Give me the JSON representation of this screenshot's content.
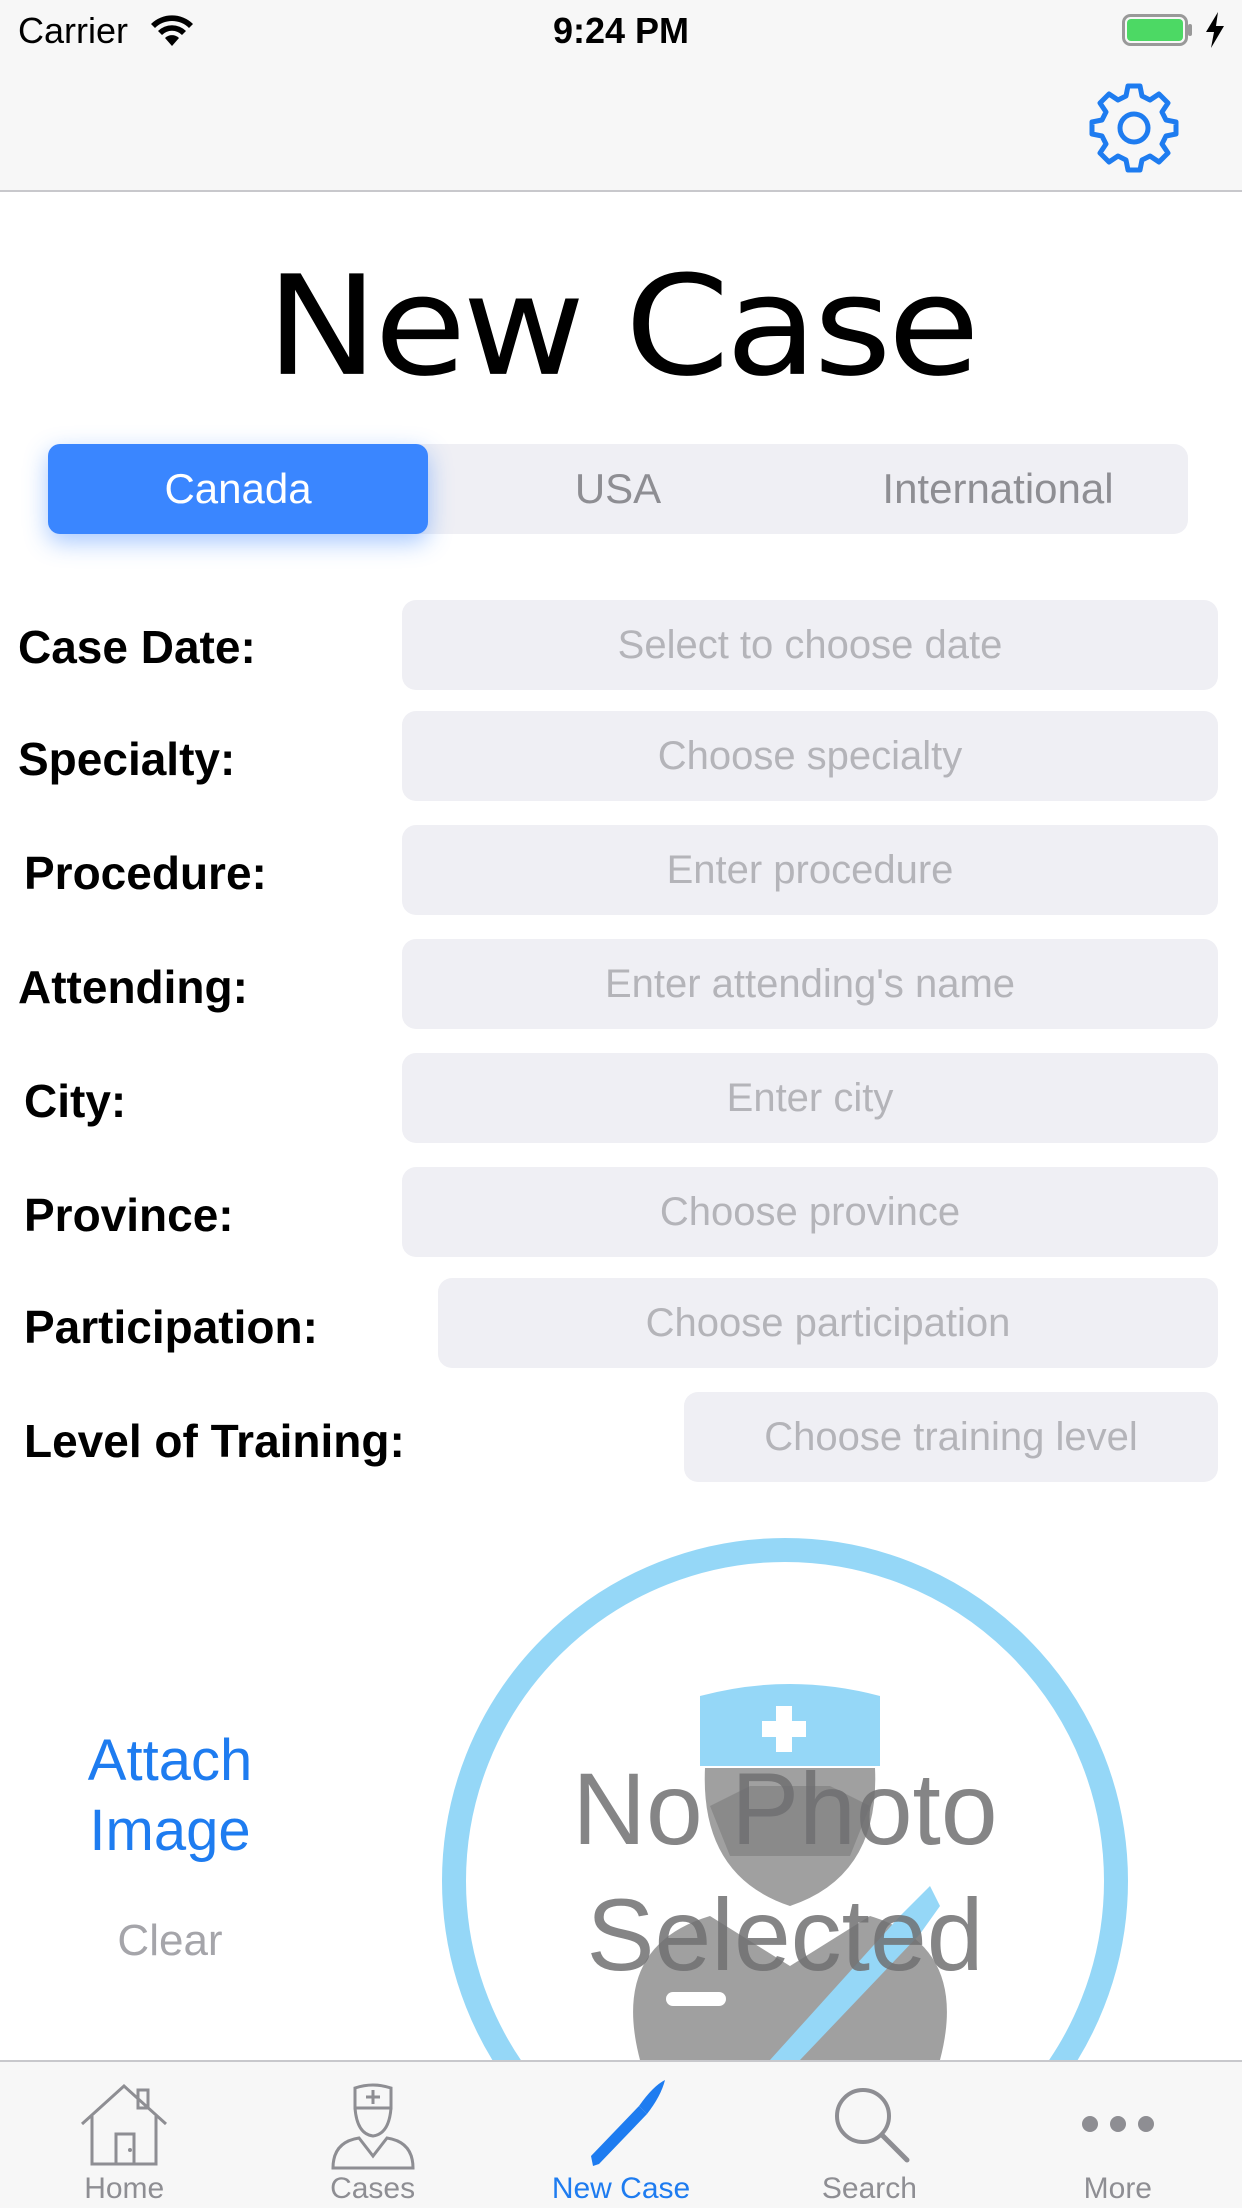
{
  "status_bar": {
    "carrier": "Carrier",
    "time": "9:24 PM",
    "battery_color": "#4cd964"
  },
  "navbar": {
    "settings_icon": "gear-icon",
    "accent_color": "#1e7cf0"
  },
  "page": {
    "title": "New Case"
  },
  "segmented": {
    "options": [
      "Canada",
      "USA",
      "International"
    ],
    "selected": "Canada",
    "active_color": "#3a86ff"
  },
  "form": {
    "fields": [
      {
        "label": "Case Date:",
        "placeholder": "Select to choose date"
      },
      {
        "label": "Specialty:",
        "placeholder": "Choose specialty"
      },
      {
        "label": "Procedure:",
        "placeholder": "Enter procedure"
      },
      {
        "label": "Attending:",
        "placeholder": "Enter attending's name"
      },
      {
        "label": "City:",
        "placeholder": "Enter city"
      },
      {
        "label": "Province:",
        "placeholder": "Choose province"
      },
      {
        "label": "Participation:",
        "placeholder": "Choose participation"
      },
      {
        "label": "Level of Training:",
        "placeholder": "Choose training level"
      }
    ]
  },
  "photo": {
    "attach_label_line1": "Attach",
    "attach_label_line2": "Image",
    "clear_label": "Clear",
    "no_photo_line1": "No Photo",
    "no_photo_line2": "Selected",
    "placeholder_icon": "doctor-icon",
    "ring_color": "#95d7f7"
  },
  "tabbar": {
    "tabs": [
      {
        "label": "Home",
        "icon": "house-icon",
        "active": false
      },
      {
        "label": "Cases",
        "icon": "doctor-icon",
        "active": false
      },
      {
        "label": "New Case",
        "icon": "scalpel-icon",
        "active": true
      },
      {
        "label": "Search",
        "icon": "magnifier-icon",
        "active": false
      },
      {
        "label": "More",
        "icon": "ellipsis-icon",
        "active": false
      }
    ]
  }
}
